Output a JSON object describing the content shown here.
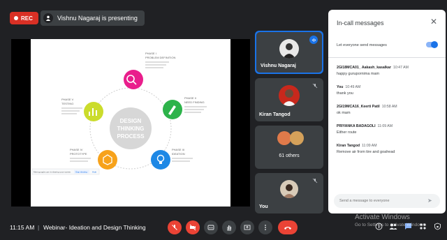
{
  "topbar": {
    "rec_label": "REC",
    "presenting_text": "Vishnu Nagaraj is presenting"
  },
  "slide": {
    "center_text": [
      "DESIGN",
      "THINKING",
      "PROCESS"
    ],
    "phases": [
      {
        "title": "PHASE I\nPROBLEM DEFINITION",
        "icon": "magnifier-icon",
        "color": "#e91e8c"
      },
      {
        "title": "PHASE II\nNEED FINDING",
        "icon": "pen-icon",
        "color": "#2db34a"
      },
      {
        "title": "PHASE III\nIDEATION",
        "icon": "bulb-icon",
        "color": "#1e88e5"
      },
      {
        "title": "PHASE IV\nPROTOTYPE",
        "icon": "cube-icon",
        "color": "#f7a21b"
      },
      {
        "title": "PHASE V\nTESTING",
        "icon": "chart-icon",
        "color": "#cbdc2c"
      }
    ],
    "screen_share_notice": "Meet.google.com is sharing your screen.",
    "stop_sharing": "Stop sharing",
    "hide": "Hide"
  },
  "participants": [
    {
      "name": "Vishnu Nagaraj",
      "speaking": true
    },
    {
      "name": "Kiran Tangod"
    },
    {
      "name": "61 others"
    },
    {
      "name": "You"
    }
  ],
  "chat": {
    "title": "In-call messages",
    "allow_label": "Let everyone send messages",
    "allow_enabled": true,
    "messages": [
      {
        "sender": "2GI18MCA01_ Aakash_kasalkar",
        "time": "10:47 AM",
        "text": "happy gurupornima mam"
      },
      {
        "sender": "You",
        "time": "10:49 AM",
        "text": "thank you"
      },
      {
        "sender": "2GI19MCA16_Keerti Patil",
        "time": "10:58 AM",
        "text": "ok mam"
      },
      {
        "sender": "PRIYANKA BADAGOLI",
        "time": "11:09 AM",
        "text": "Either route"
      },
      {
        "sender": "Kiran Tangod",
        "time": "11:09 AM",
        "text": "Remove air from tire and goahead"
      }
    ],
    "input_placeholder": "Send a message to everyone"
  },
  "bottombar": {
    "time": "11:15 AM",
    "separator": "|",
    "meeting_title": "Webinar- Ideation and Design Thinking"
  },
  "watermark": {
    "line1": "Activate Windows",
    "line2": "Go to Settings to activate Windows."
  },
  "colors": {
    "accent": "#1a73e8",
    "danger": "#ea4335",
    "background": "#202124"
  }
}
